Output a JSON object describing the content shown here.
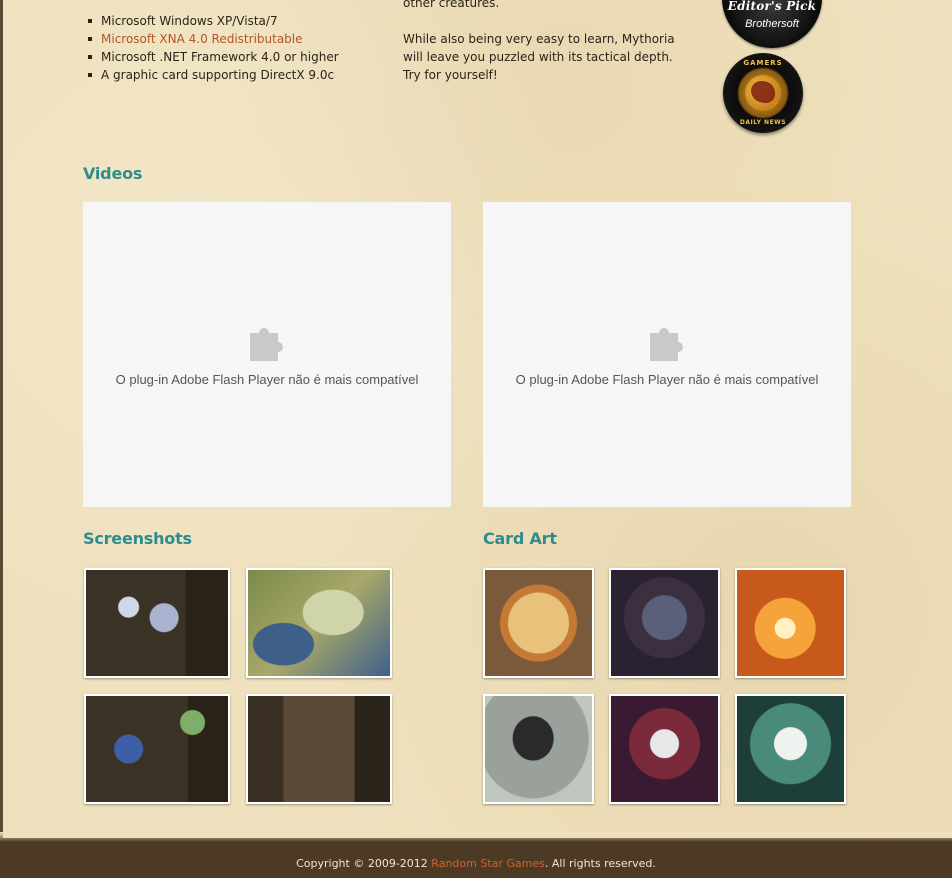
{
  "requirements": {
    "items": [
      "Microsoft Windows XP/Vista/7",
      "Microsoft XNA 4.0 Redistributable",
      "Microsoft .NET Framework 4.0 or higher",
      "A graphic card supporting DirectX 9.0c"
    ]
  },
  "about": {
    "p1": "other creatures.",
    "p2": "While also being very easy to learn, Mythoria will leave you puzzled with its tactical depth. Try for yourself!"
  },
  "badges": {
    "editors_pick_title": "Editor's Pick",
    "editors_pick_brand": "Brothersoft",
    "gamers_top": "GAMERS",
    "gamers_bottom": "DAILY NEWS"
  },
  "sections": {
    "videos_title": "Videos",
    "screenshots_title": "Screenshots",
    "card_art_title": "Card Art"
  },
  "flash": {
    "message": "O plug-in Adobe Flash Player não é mais compatível",
    "icon": "puzzle-piece-icon"
  },
  "footer": {
    "prefix": "Copyright © 2009-2012 ",
    "company": "Random Star Games",
    "suffix": ". All rights reserved."
  },
  "colors": {
    "heading": "#2e8c8c",
    "link": "#b4552a",
    "footer_link": "#d4612a",
    "background": "#efe1bd"
  }
}
